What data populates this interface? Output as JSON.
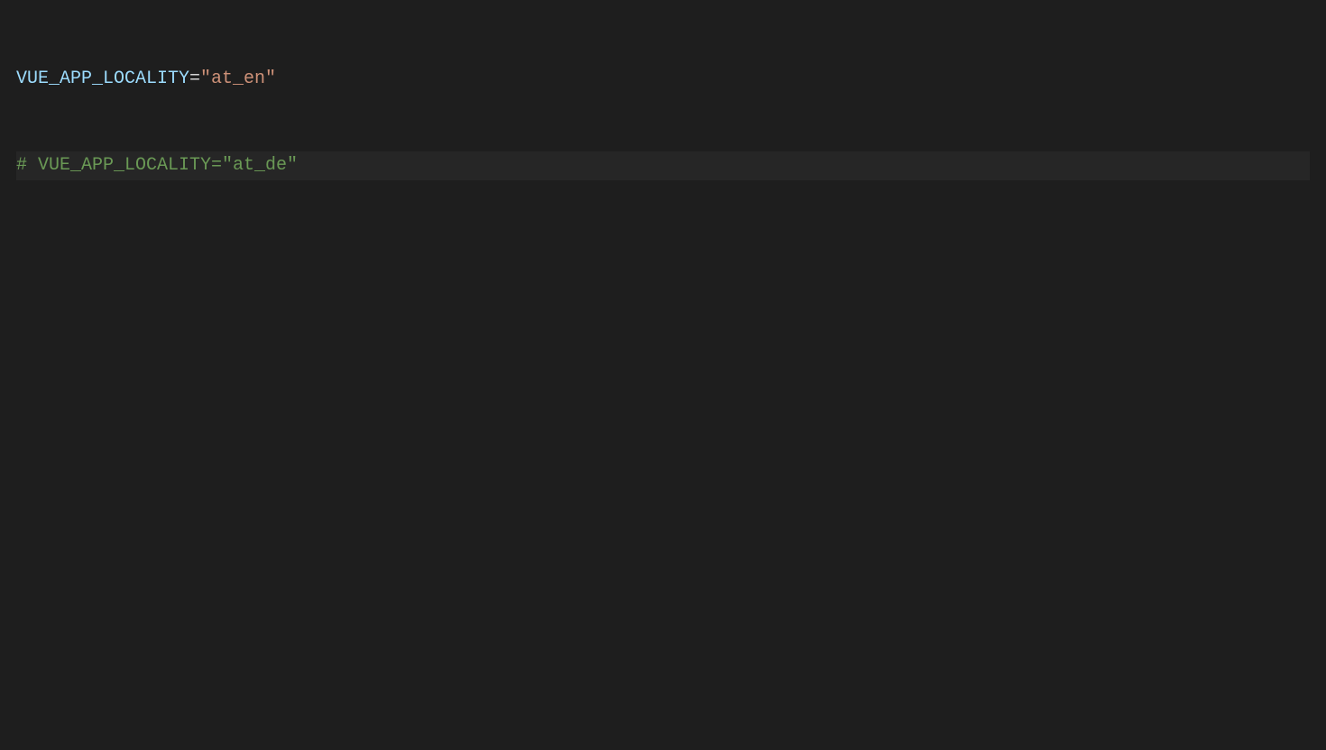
{
  "lines": {
    "line1": {
      "variable": "VUE_APP_LOCALITY",
      "operator": "=",
      "string": "\"at_en\""
    },
    "line2": {
      "comment": "# VUE_APP_LOCALITY=\"at_de\""
    }
  }
}
